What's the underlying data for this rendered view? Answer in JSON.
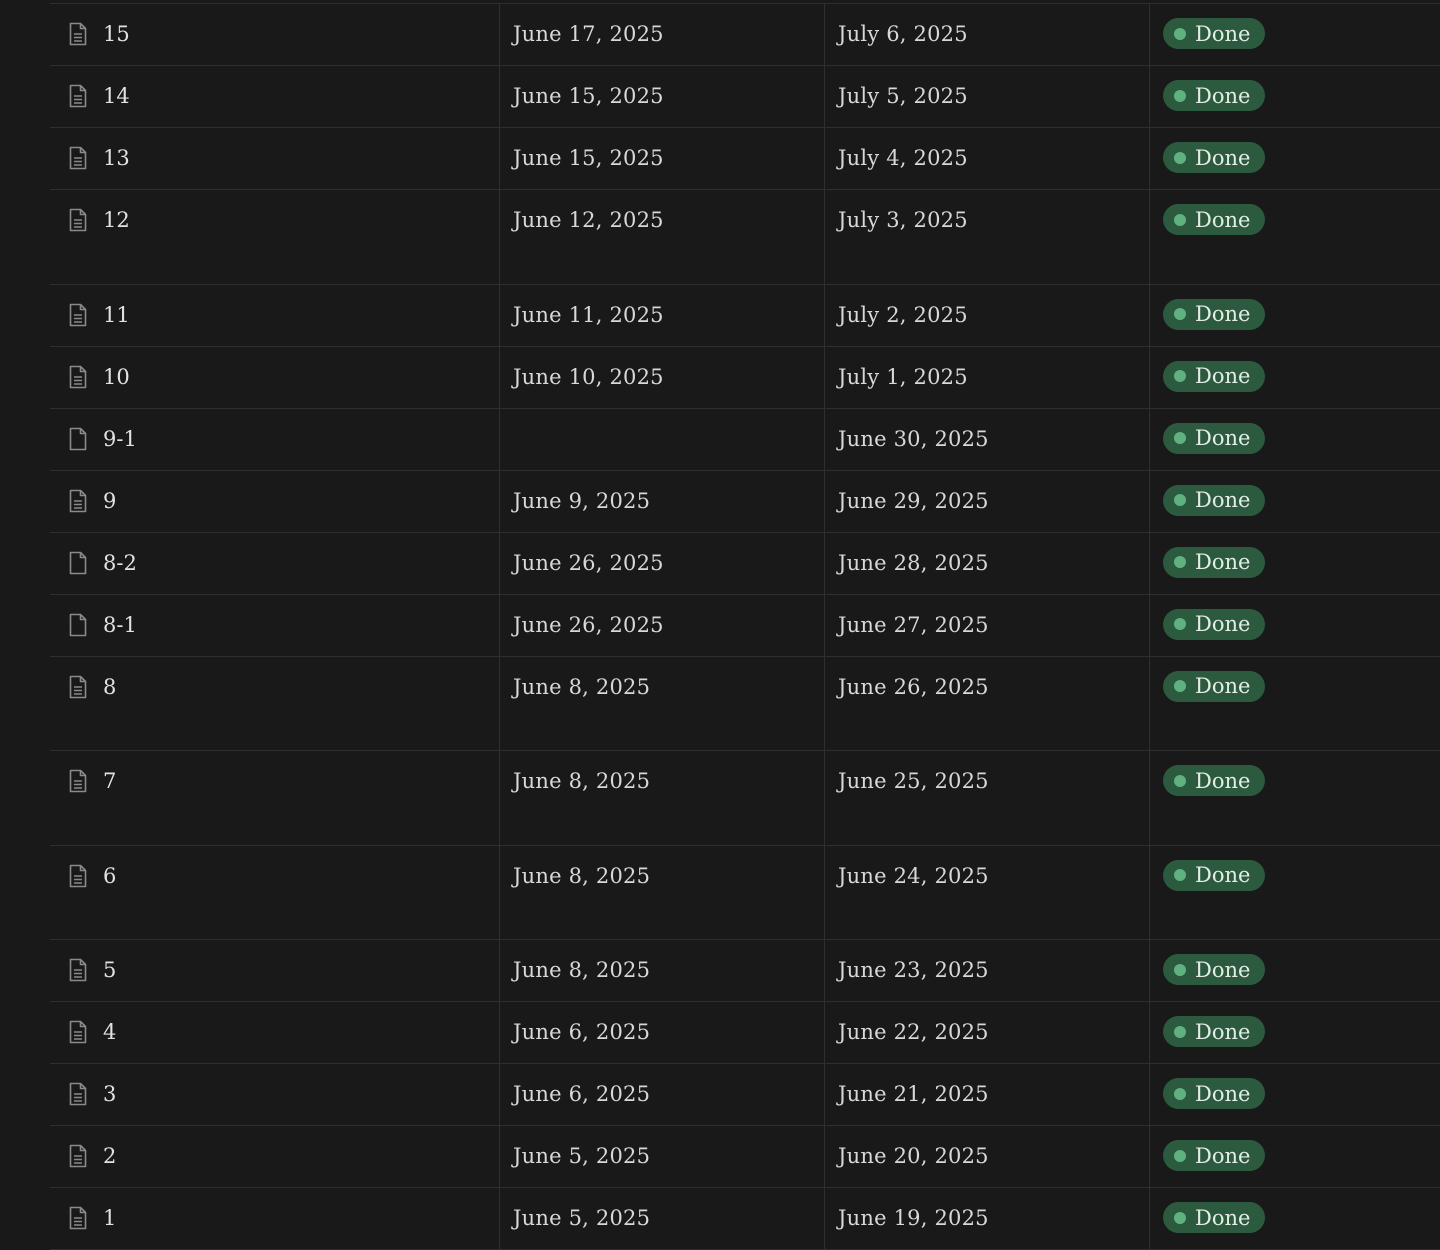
{
  "table": {
    "rows": [
      {
        "name": "15",
        "start": "June 17, 2025",
        "end": "July 6, 2025",
        "status": "Done",
        "icon": "page-with-lines",
        "tall": false
      },
      {
        "name": "14",
        "start": "June 15, 2025",
        "end": "July 5, 2025",
        "status": "Done",
        "icon": "page-with-lines",
        "tall": false
      },
      {
        "name": "13",
        "start": "June 15, 2025",
        "end": "July 4, 2025",
        "status": "Done",
        "icon": "page-with-lines",
        "tall": false
      },
      {
        "name": "12",
        "start": "June 12, 2025",
        "end": "July 3, 2025",
        "status": "Done",
        "icon": "page-with-lines",
        "tall": true
      },
      {
        "name": "11",
        "start": "June 11, 2025",
        "end": "July 2, 2025",
        "status": "Done",
        "icon": "page-with-lines",
        "tall": false
      },
      {
        "name": "10",
        "start": "June 10, 2025",
        "end": "July 1, 2025",
        "status": "Done",
        "icon": "page-with-lines",
        "tall": false
      },
      {
        "name": "9-1",
        "start": "",
        "end": "June 30, 2025",
        "status": "Done",
        "icon": "page-blank",
        "tall": false
      },
      {
        "name": "9",
        "start": "June 9, 2025",
        "end": "June 29, 2025",
        "status": "Done",
        "icon": "page-with-lines",
        "tall": false
      },
      {
        "name": "8-2",
        "start": "June 26, 2025",
        "end": "June 28, 2025",
        "status": "Done",
        "icon": "page-blank",
        "tall": false
      },
      {
        "name": "8-1",
        "start": "June 26, 2025",
        "end": "June 27, 2025",
        "status": "Done",
        "icon": "page-blank",
        "tall": false
      },
      {
        "name": "8",
        "start": "June 8, 2025",
        "end": "June 26, 2025",
        "status": "Done",
        "icon": "page-with-lines",
        "tall": true
      },
      {
        "name": "7",
        "start": "June 8, 2025",
        "end": "June 25, 2025",
        "status": "Done",
        "icon": "page-with-lines",
        "tall": true
      },
      {
        "name": "6",
        "start": "June 8, 2025",
        "end": "June 24, 2025",
        "status": "Done",
        "icon": "page-with-lines",
        "tall": true
      },
      {
        "name": "5",
        "start": "June 8, 2025",
        "end": "June 23, 2025",
        "status": "Done",
        "icon": "page-with-lines",
        "tall": false
      },
      {
        "name": "4",
        "start": "June 6, 2025",
        "end": "June 22, 2025",
        "status": "Done",
        "icon": "page-with-lines",
        "tall": false
      },
      {
        "name": "3",
        "start": "June 6, 2025",
        "end": "June 21, 2025",
        "status": "Done",
        "icon": "page-with-lines",
        "tall": false
      },
      {
        "name": "2",
        "start": "June 5, 2025",
        "end": "June 20, 2025",
        "status": "Done",
        "icon": "page-with-lines",
        "tall": false
      },
      {
        "name": "1",
        "start": "June 5, 2025",
        "end": "June 19, 2025",
        "status": "Done",
        "icon": "page-with-lines",
        "tall": false
      }
    ]
  },
  "colors": {
    "background": "#191919",
    "grid": "#2f2f2f",
    "status_done_bg": "#2b5a3f",
    "status_done_dot": "#5fb27f"
  }
}
